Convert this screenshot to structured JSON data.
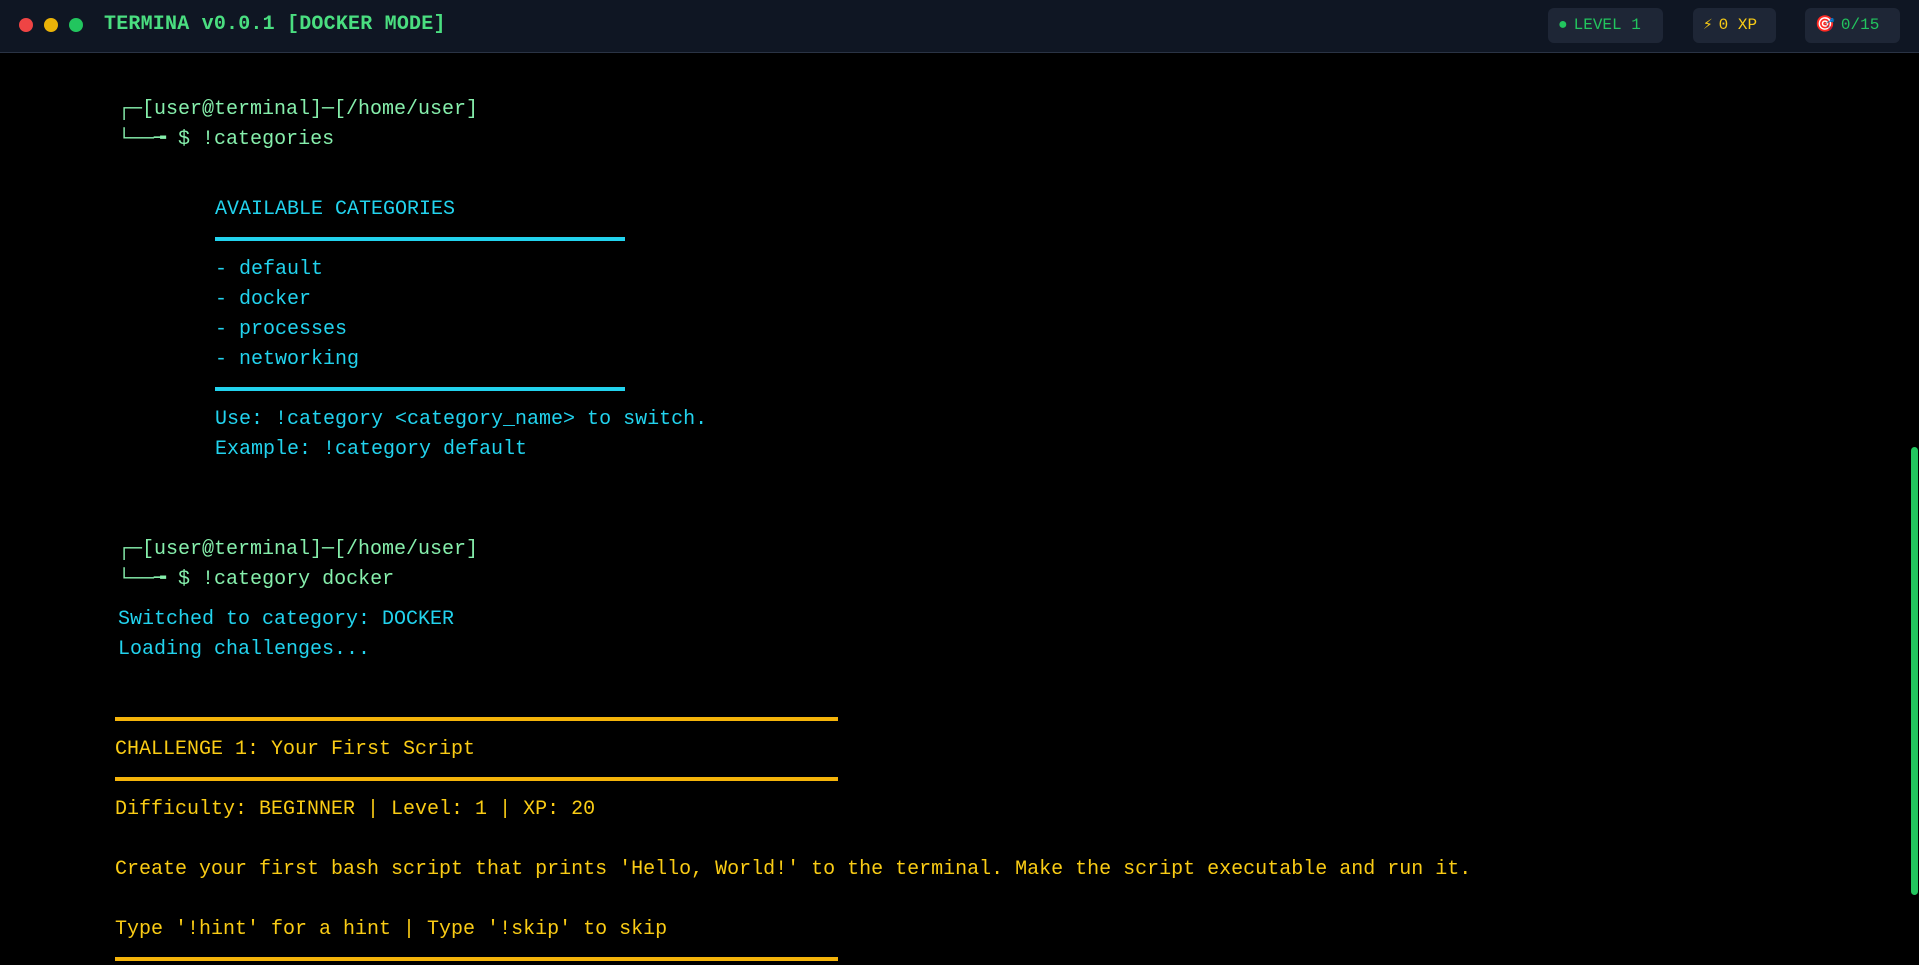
{
  "window": {
    "title": "TERMINA v0.0.1 [DOCKER MODE]",
    "badges": {
      "level": {
        "icon": "●",
        "label": "LEVEL 1",
        "color": "#22c55e"
      },
      "xp": {
        "icon": "⚡",
        "label": "0 XP",
        "color": "#facc15"
      },
      "progress": {
        "icon": "🎯",
        "label": "0/15",
        "color": "#22c55e"
      }
    }
  },
  "terminal": {
    "block1": {
      "prompt_top": "┌─[user@terminal]─[/home/user]",
      "prompt_bottom": "└──╼ $ !categories",
      "heading": "AVAILABLE CATEGORIES",
      "items": [
        "- default",
        "- docker",
        "- processes",
        "- networking"
      ],
      "usage": "Use: !category <category_name> to switch.",
      "example": "Example: !category default"
    },
    "block2": {
      "prompt_top": "┌─[user@terminal]─[/home/user]",
      "prompt_bottom": "└──╼ $ !category docker",
      "switched": "Switched to category: DOCKER",
      "loading": "Loading challenges..."
    },
    "challenge": {
      "title": "CHALLENGE 1: Your First Script",
      "meta": "Difficulty: BEGINNER | Level: 1 | XP: 20",
      "description": "Create your first bash script that prints 'Hello, World!' to the terminal. Make the script executable and run it.",
      "help": "Type '!hint' for a hint | Type '!skip' to skip"
    }
  },
  "colors": {
    "prompt": "#86efac",
    "info": "#22d3ee",
    "challenge": "#facc15",
    "titlebar_bg": "#0f1623"
  }
}
